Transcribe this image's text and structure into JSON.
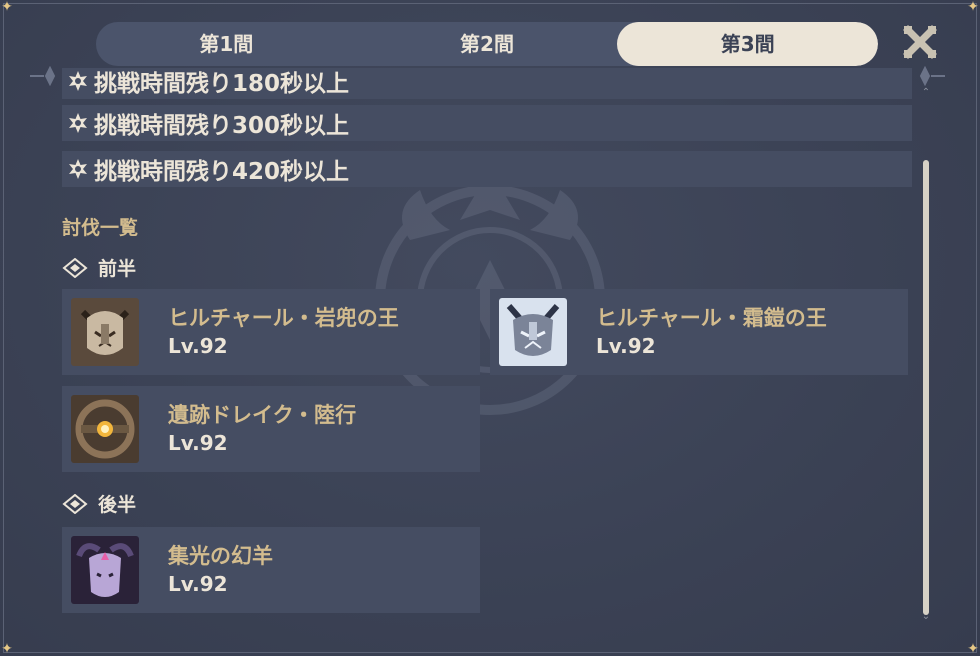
{
  "tabs": [
    {
      "label": "第1間",
      "active": false
    },
    {
      "label": "第2間",
      "active": false
    },
    {
      "label": "第3間",
      "active": true
    }
  ],
  "conditions": [
    {
      "text": "挑戦時間残り180秒以上"
    },
    {
      "text": "挑戦時間残り300秒以上"
    },
    {
      "text": "挑戦時間残り420秒以上"
    }
  ],
  "enemy_list_title": "討伐一覧",
  "first_half": {
    "label": "前半",
    "enemies": [
      {
        "name": "ヒルチャール・岩兜の王",
        "level": "Lv.92",
        "icon": "lawachurl-stone-portrait"
      },
      {
        "name": "ヒルチャール・霜鎧の王",
        "level": "Lv.92",
        "icon": "lawachurl-frost-portrait"
      },
      {
        "name": "遺跡ドレイク・陸行",
        "level": "Lv.92",
        "icon": "ruin-drake-portrait"
      }
    ]
  },
  "second_half": {
    "label": "後半",
    "enemies": [
      {
        "name": "集光の幻羊",
        "level": "Lv.92",
        "icon": "phantom-ram-portrait"
      }
    ]
  },
  "colors": {
    "background": "#3b4255",
    "row": "#454d62",
    "gold": "#d3bc8e",
    "cream": "#ece5d8",
    "accent": "#e6c886"
  }
}
